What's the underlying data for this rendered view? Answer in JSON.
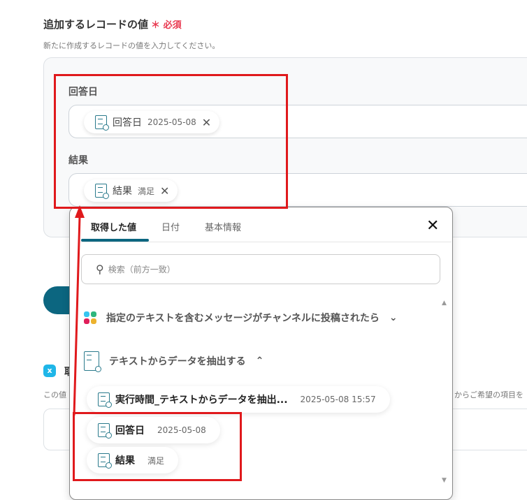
{
  "section": {
    "title": "追加するレコードの値",
    "required_mark": "＊",
    "required": "必須",
    "description": "新たに作成するレコードの値を入力してください。"
  },
  "fields": [
    {
      "label": "回答日",
      "chip_name": "回答日",
      "chip_value": "2025-05-08"
    },
    {
      "label": "結果",
      "chip_name": "結果",
      "chip_value": "満足"
    }
  ],
  "background": {
    "section2_title_fragment": "取",
    "section2_desc_left": "この値",
    "section2_desc_right": "からご希望の項目を"
  },
  "popup": {
    "tabs": [
      "取得した値",
      "日付",
      "基本情報"
    ],
    "search_placeholder": "検索（前方一致）",
    "groups": [
      {
        "label": "指定のテキストを含むメッセージがチャンネルに投稿されたら",
        "icon": "slack-icon",
        "expanded": false
      },
      {
        "label": "テキストからデータを抽出する",
        "icon": "document-search-icon",
        "expanded": true
      }
    ],
    "items": [
      {
        "name": "実行時間_テキストからデータを抽出...",
        "value": "2025-05-08 15:57"
      },
      {
        "name": "回答日",
        "value": "2025-05-08"
      },
      {
        "name": "結果",
        "value": "満足"
      }
    ]
  },
  "colors": {
    "accent": "#0c6680",
    "annotation": "#e0191c",
    "required": "#e8384f"
  }
}
